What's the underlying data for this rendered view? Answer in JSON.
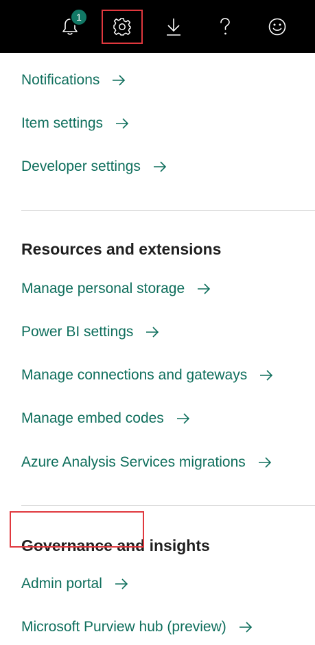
{
  "topbar": {
    "notifications_badge": "1",
    "icons": [
      "bell-icon",
      "gear-icon",
      "download-icon",
      "help-icon",
      "smiley-icon"
    ]
  },
  "settings": {
    "links": [
      {
        "label": "Notifications"
      },
      {
        "label": "Item settings"
      },
      {
        "label": "Developer settings"
      }
    ]
  },
  "resources": {
    "heading": "Resources and extensions",
    "links": [
      {
        "label": "Manage personal storage"
      },
      {
        "label": "Power BI settings"
      },
      {
        "label": "Manage connections and gateways"
      },
      {
        "label": "Manage embed codes"
      },
      {
        "label": "Azure Analysis Services migrations"
      }
    ]
  },
  "governance": {
    "heading": "Governance and insights",
    "links": [
      {
        "label": "Admin portal"
      },
      {
        "label": "Microsoft Purview hub (preview)"
      }
    ]
  },
  "colors": {
    "topbar_bg": "#000000",
    "link": "#0e6e5c",
    "badge": "#117865",
    "highlight_outline": "#e0383e"
  }
}
